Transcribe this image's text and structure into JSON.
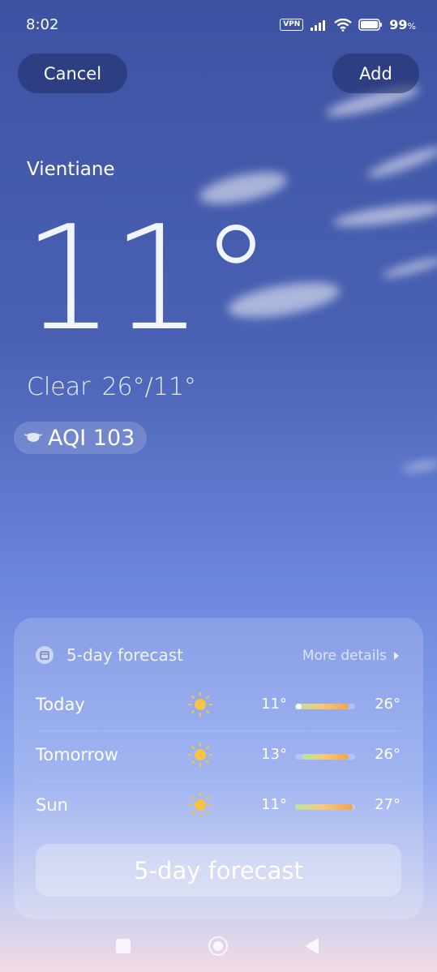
{
  "status_bar": {
    "time": "8:02",
    "vpn_label": "VPN",
    "battery": "99",
    "battery_unit": "%"
  },
  "header": {
    "cancel_label": "Cancel",
    "add_label": "Add"
  },
  "weather": {
    "city": "Vientiane",
    "temperature": "11°",
    "condition": "Clear",
    "high_low": "26°/11°",
    "aqi": "AQI 103"
  },
  "forecast": {
    "title": "5-day forecast",
    "more_details": "More details",
    "days": [
      {
        "day": "Today",
        "icon": "sun-icon",
        "low": "11°",
        "high": "26°"
      },
      {
        "day": "Tomorrow",
        "icon": "sun-icon",
        "low": "13°",
        "high": "26°"
      },
      {
        "day": "Sun",
        "icon": "sun-icon",
        "low": "11°",
        "high": "27°"
      }
    ],
    "button_label": "5-day forecast"
  },
  "colors": {
    "sun": "#f6c342",
    "bar_cool": "#b8e4a8",
    "bar_warm": "#f5a24e"
  }
}
